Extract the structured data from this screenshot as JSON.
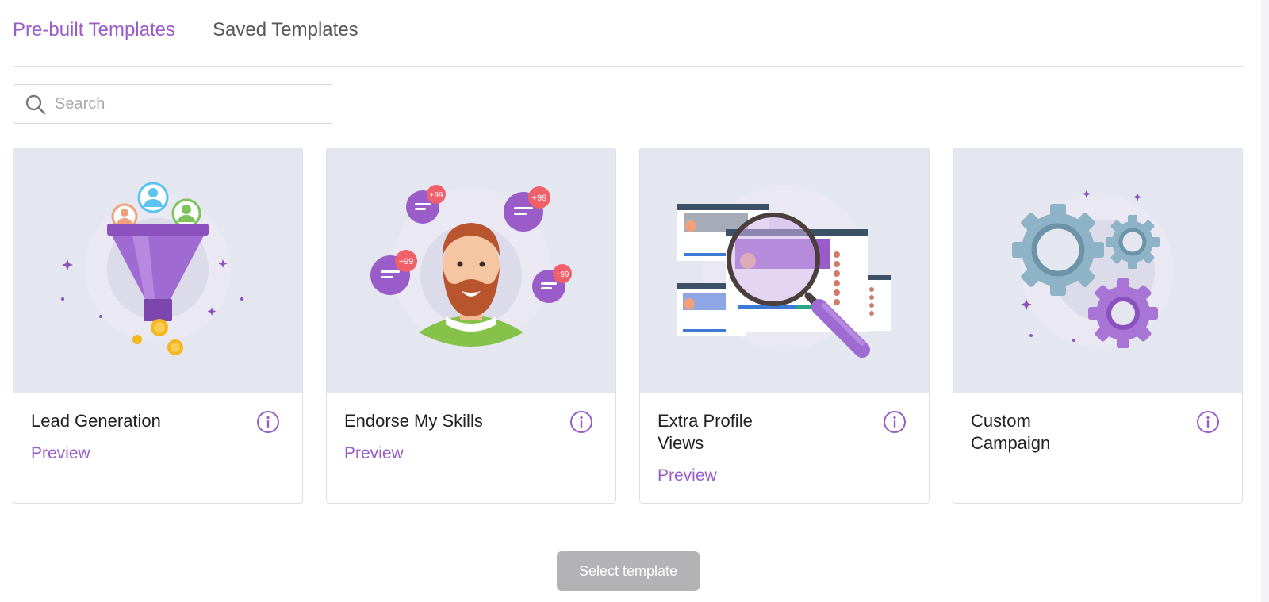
{
  "tabs": {
    "prebuilt": "Pre-built Templates",
    "saved": "Saved Templates"
  },
  "search": {
    "placeholder": "Search",
    "value": ""
  },
  "cards": [
    {
      "title": "Lead Generation",
      "preview": "Preview",
      "illustration": "sales-funnel-illustration"
    },
    {
      "title": "Endorse My Skills",
      "preview": "Preview",
      "illustration": "bearded-man-notifications-illustration"
    },
    {
      "title": "Extra Profile Views",
      "preview": "Preview",
      "illustration": "magnifying-glass-profile-illustration"
    },
    {
      "title": "Custom Campaign",
      "preview": "",
      "illustration": "gears-illustration"
    }
  ],
  "footer": {
    "select_label": "Select template"
  },
  "colors": {
    "accent": "#9a5cc9",
    "card_bg": "#e4e7ef",
    "disabled_button": "#b3b3b6",
    "badge": "#f0606a"
  }
}
